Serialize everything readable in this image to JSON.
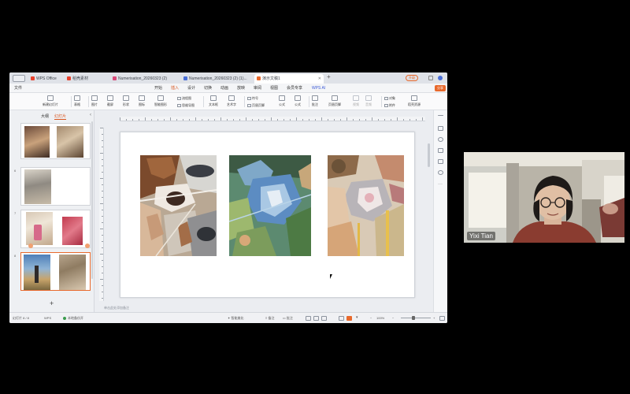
{
  "window": {
    "tabs": [
      {
        "label": "WPS Office",
        "icon_color": "#e8412c"
      },
      {
        "label": "稻壳素材",
        "icon_color": "#e8412c"
      },
      {
        "label": "Numerisation_20260323 (2)",
        "icon_color": "#d84a7a"
      },
      {
        "label": "Numerisation_20260323 (2) (1)...",
        "icon_color": "#4a6fd8"
      },
      {
        "label": "演示文稿1",
        "icon_color": "#e8692c"
      }
    ],
    "upgrade_label": "升级",
    "menu": {
      "file": "文件",
      "items": [
        "开始",
        "插入",
        "设计",
        "切换",
        "动画",
        "放映",
        "审阅",
        "视图",
        "会员专享"
      ],
      "active_index": 1,
      "ai_label": "WPS AI",
      "share_label": "分享"
    },
    "ribbon": {
      "new_slide": "新建幻灯片",
      "table": "表格",
      "picture": "图片",
      "screenshot": "截屏",
      "shape": "形状",
      "icon": "图标",
      "smart_graphic": "智能图形",
      "mindmap": "流程图",
      "flowchart": "思维导图",
      "textbox": "文本框",
      "art_text": "艺术字",
      "symbol": "符号",
      "formula": "公式",
      "header_footer": "页眉页脚",
      "comment": "批注",
      "video": "视频",
      "audio": "音频",
      "object": "对象",
      "attachment": "附件",
      "resources": "稻壳资源"
    },
    "left_panel": {
      "tab_outline": "大纲",
      "tab_slides": "幻灯片",
      "slide_numbers": [
        "6",
        "7",
        "8"
      ],
      "add_symbol": "+"
    },
    "notes_placeholder": "单击此处添加备注",
    "status": {
      "slide_info": "幻灯片 8 / 8",
      "app": "WPS",
      "backup": "本地备份开",
      "smart_beautify": "智能美化",
      "notes": "备注",
      "comments": "批注",
      "zoom": "100%"
    }
  },
  "participant": {
    "name": "Yixi Tian"
  }
}
